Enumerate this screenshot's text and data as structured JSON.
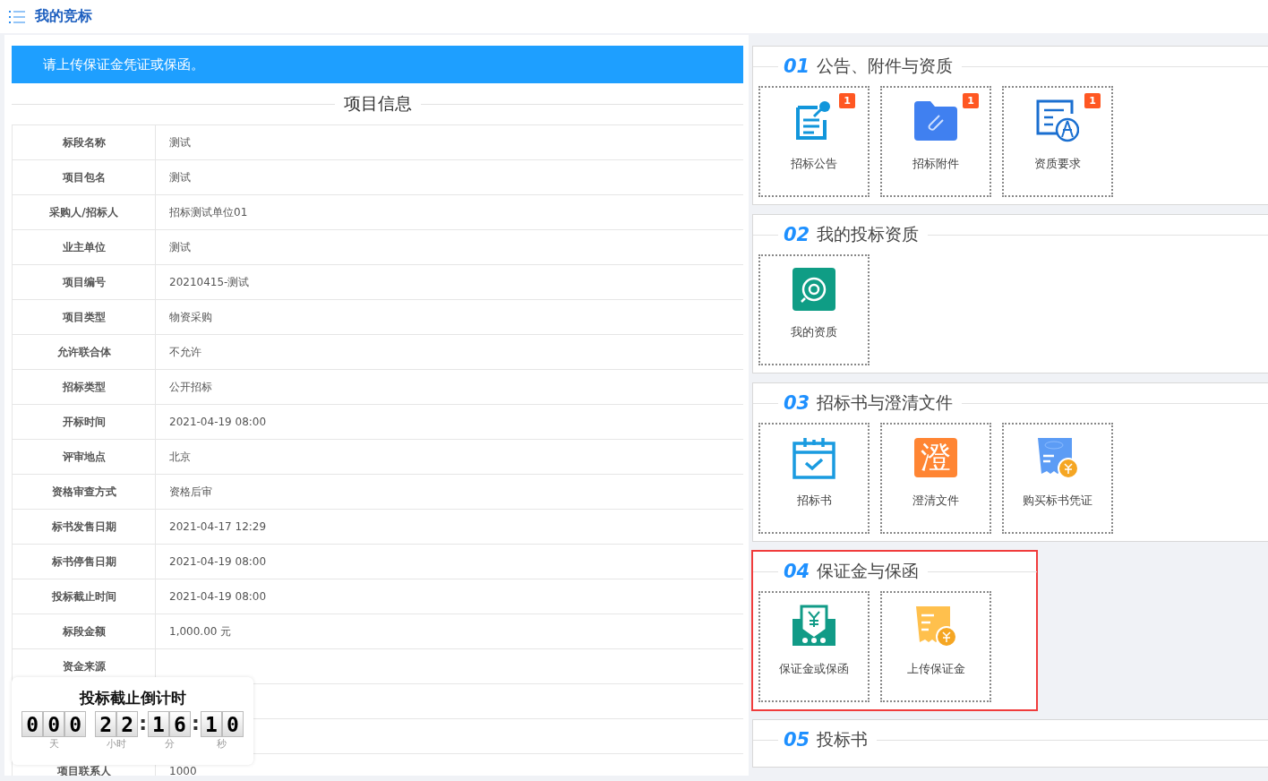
{
  "header": {
    "title": "我的竞标"
  },
  "notice": "请上传保证金凭证或保函。",
  "project_info": {
    "title": "项目信息",
    "rows": [
      {
        "label": "标段名称",
        "value": "测试"
      },
      {
        "label": "项目包名",
        "value": "测试"
      },
      {
        "label": "采购人/招标人",
        "value": "招标测试单位01"
      },
      {
        "label": "业主单位",
        "value": "测试"
      },
      {
        "label": "项目编号",
        "value": "20210415-测试"
      },
      {
        "label": "项目类型",
        "value": "物资采购"
      },
      {
        "label": "允许联合体",
        "value": "不允许"
      },
      {
        "label": "招标类型",
        "value": "公开招标"
      },
      {
        "label": "开标时间",
        "value": "2021-04-19 08:00"
      },
      {
        "label": "评审地点",
        "value": "北京"
      },
      {
        "label": "资格审查方式",
        "value": "资格后审"
      },
      {
        "label": "标书发售日期",
        "value": "2021-04-17 12:29"
      },
      {
        "label": "标书停售日期",
        "value": "2021-04-19 08:00"
      },
      {
        "label": "投标截止时间",
        "value": "2021-04-19 08:00"
      },
      {
        "label": "标段金额",
        "value": "1,000.00 元"
      },
      {
        "label": "资金来源"
      },
      {},
      {},
      {
        "label": "项目联系人",
        "value": "1000"
      }
    ]
  },
  "countdown": {
    "title": "投标截止倒计时",
    "groups": [
      {
        "digits": [
          "0",
          "0",
          "0"
        ],
        "unit": "天"
      },
      {
        "digits": [
          "2",
          "2"
        ],
        "unit": "小时"
      },
      {
        "separator": ":",
        "digits": [
          "1",
          "6"
        ],
        "unit": "分"
      },
      {
        "separator": ":",
        "digits": [
          "1",
          "0"
        ],
        "unit": "秒"
      }
    ]
  },
  "sections": [
    {
      "number": "01",
      "title": "公告、附件与资质",
      "highlighted": false,
      "tiles": [
        {
          "kind": "notice",
          "label": "招标公告",
          "badge": "1"
        },
        {
          "kind": "attachment",
          "label": "招标附件",
          "badge": "1"
        },
        {
          "kind": "requirement",
          "label": "资质要求",
          "badge": "1"
        }
      ]
    },
    {
      "number": "02",
      "title": "我的投标资质",
      "highlighted": false,
      "tiles": [
        {
          "kind": "qualification",
          "label": "我的资质"
        }
      ]
    },
    {
      "number": "03",
      "title": "招标书与澄清文件",
      "highlighted": false,
      "tiles": [
        {
          "kind": "tender-book",
          "label": "招标书"
        },
        {
          "kind": "clarify",
          "label": "澄清文件",
          "glyph": "澄"
        },
        {
          "kind": "purchase-voucher",
          "label": "购买标书凭证"
        }
      ]
    },
    {
      "number": "04",
      "title": "保证金与保函",
      "highlighted": true,
      "tiles": [
        {
          "kind": "deposit",
          "label": "保证金或保函"
        },
        {
          "kind": "upload-deposit",
          "label": "上传保证金"
        }
      ]
    },
    {
      "number": "05",
      "title": "投标书",
      "highlighted": false
    }
  ]
}
